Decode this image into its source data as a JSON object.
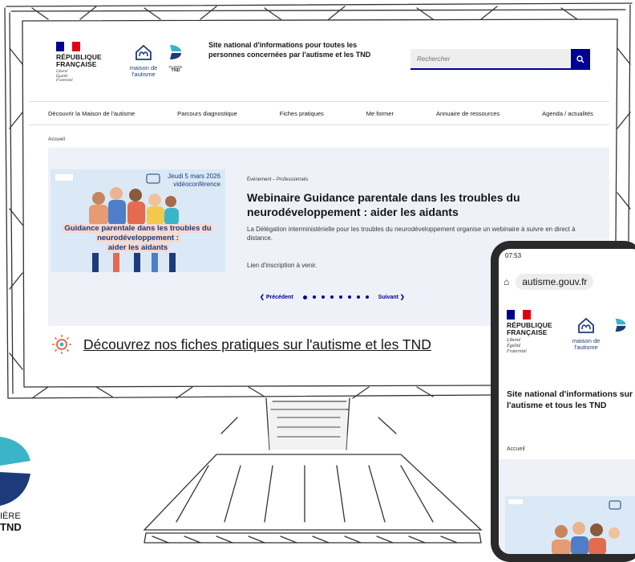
{
  "header": {
    "rf_name": "RÉPUBLIQUE FRANÇAISE",
    "rf_motto": [
      "Liberté",
      "Égalité",
      "Fraternité"
    ],
    "maison_line1": "maison de",
    "maison_line2": "l'autisme",
    "filiere_label": "FILIÈRE",
    "tnd_label": "TND",
    "tagline": "Site national d'informations pour toutes les personnes concernées par l'autisme et les TND",
    "search_placeholder": "Rechercher"
  },
  "nav": {
    "items": [
      "Découvrir la Maison de l'autisme",
      "Parcours diagnostique",
      "Fiches pratiques",
      "Me former",
      "Annuaire de ressources",
      "Agenda / actualités"
    ]
  },
  "breadcrumb": "Accueil",
  "event": {
    "image_date": "Jeudi 5 mars 2026",
    "image_mode": "vidéoconférence",
    "image_caption": [
      "Guidance parentale dans les troubles du",
      "neurodéveloppement :",
      "aider les aidants"
    ],
    "type": "Événement – Professionnels",
    "title": "Webinaire Guidance parentale dans les troubles du neurodéveloppement : aider les aidants",
    "description": "La Délégation interministérielle pour les troubles du neurodéveloppement organise un webinaire à suivre en direct à distance.",
    "link_note": "Lien d'inscription à venir."
  },
  "pager": {
    "prev": "Précédent",
    "next": "Suivant",
    "count": 8,
    "active": 0
  },
  "fiches_heading": "Découvrez nos fiches pratiques sur l'autisme et les TND",
  "phone": {
    "time": "07:53",
    "url": "autisme.gouv.fr",
    "tagline": "Site national d'informations sur l'autisme et tous les TND",
    "breadcrumb": "Accueil"
  },
  "corner_logo": {
    "line1": "IÈRE",
    "line2": "TND"
  },
  "colors": {
    "accent": "#000091",
    "brand_blue": "#1d3b7a",
    "flag_blue": "#000091",
    "flag_red": "#e1000f",
    "tnd_teal": "#3cb4c8"
  }
}
